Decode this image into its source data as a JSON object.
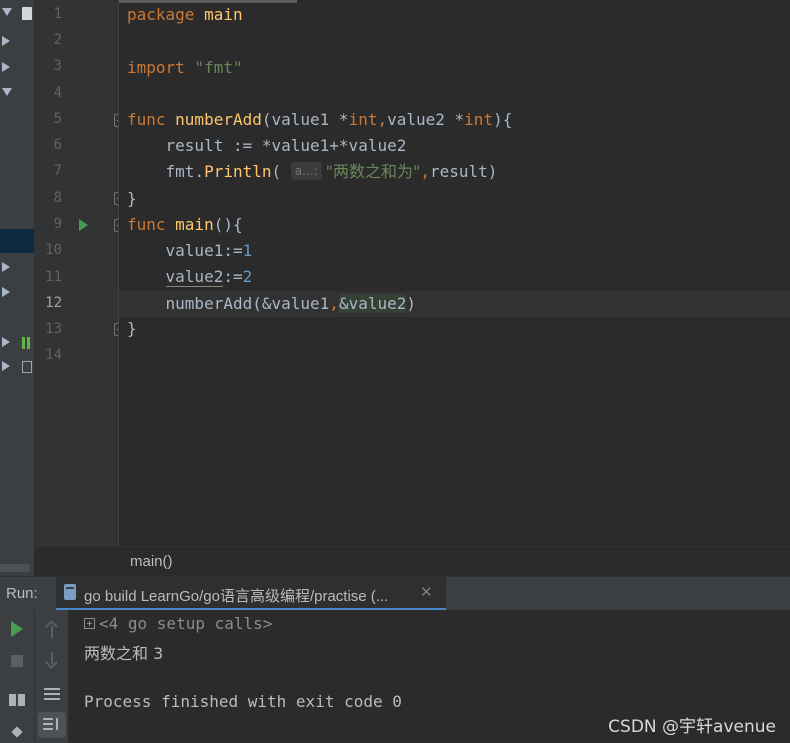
{
  "editor": {
    "lines": [
      {
        "no": "1"
      },
      {
        "no": "2"
      },
      {
        "no": "3"
      },
      {
        "no": "4"
      },
      {
        "no": "5"
      },
      {
        "no": "6"
      },
      {
        "no": "7"
      },
      {
        "no": "8"
      },
      {
        "no": "9"
      },
      {
        "no": "10"
      },
      {
        "no": "11"
      },
      {
        "no": "12"
      },
      {
        "no": "13"
      },
      {
        "no": "14"
      }
    ],
    "code": {
      "l1_kw": "package",
      "l1_name": " main",
      "l3_kw": "import",
      "l3_str": " \"fmt\"",
      "l5_kw": "func",
      "l5_fn": " numberAdd",
      "l5_rest_a": "(value1 *",
      "l5_type1": "int",
      "l5_comma": ",",
      "l5_rest_b": "value2 *",
      "l5_type2": "int",
      "l5_end": "){",
      "l6": "    result := *value1+*value2",
      "l7_pkg": "    fmt",
      "l7_dot": ".",
      "l7_fn": "Println",
      "l7_paren": "( ",
      "l7_hint": "a...:",
      "l7_str": "\"两数之和为\"",
      "l7_comma": ",",
      "l7_rest": "result)",
      "l8": "}",
      "l9_kw": "func",
      "l9_fn": " main",
      "l9_rest": "(){",
      "l10_a": "    value1:=",
      "l10_num": "1",
      "l11_ind": "    ",
      "l11_a": "value2",
      "l11_b": ":=",
      "l11_num": "2",
      "l12_ind": "    ",
      "l12_fn": "numberAdd",
      "l12_a": "(&value1",
      "l12_comma": ",",
      "l12_b": "&value2",
      "l12_end": ")",
      "l13": "}"
    }
  },
  "breadcrumb": {
    "label": "main()"
  },
  "run_panel": {
    "label": "Run:",
    "tab_label": "go build LearnGo/go语言高级编程/practise (...",
    "close_glyph": "✕"
  },
  "console": {
    "setup": "<4 go setup calls>",
    "output": "两数之和 3",
    "exit": "Process finished with exit code 0"
  },
  "watermark": "CSDN @宇轩avenue",
  "colors": {
    "background": "#2b2b2b",
    "keyword": "#cc7832",
    "function": "#ffc66d",
    "string": "#6a8759",
    "number": "#6897bb",
    "run_green": "#499c54"
  }
}
